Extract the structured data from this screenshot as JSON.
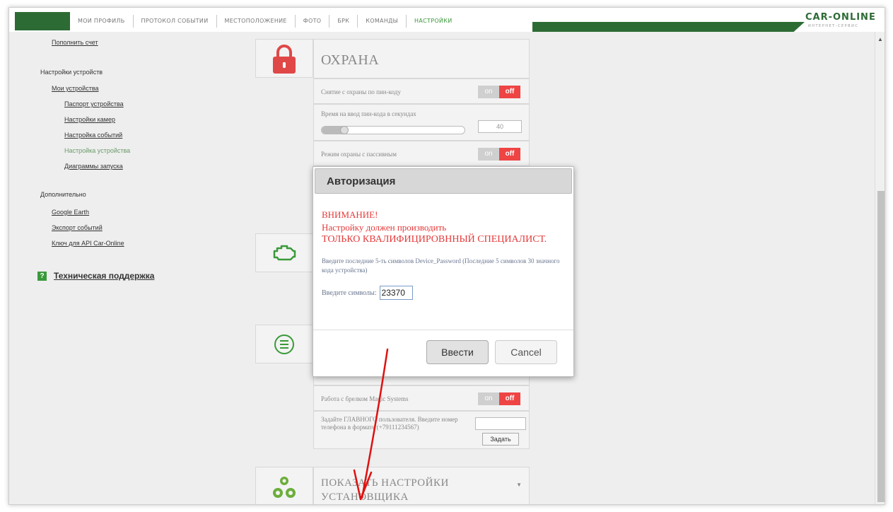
{
  "nav": {
    "tabs": [
      "МОИ ПРОФИЛЬ",
      "ПРОТОКОЛ СОБЫТИИ",
      "МЕСТОПОЛОЖЕНИЕ",
      "ФОТО",
      "БРК",
      "КОМАНДЫ",
      "НАСТРОЙКИ"
    ],
    "active_tab": "НАСТРОЙКИ",
    "logo": "CAR-ONLINE",
    "logo_sub": "ИНТЕРНЕТ-СЕРВИС"
  },
  "sidebar": {
    "topup": "Пополнить счет",
    "device_settings_heading": "Настройки устройств",
    "my_devices": "Мои устройства",
    "device_passport": "Паспорт устройства",
    "camera_settings": "Настройки камер",
    "event_settings": "Настройка событий",
    "device_setting_current": "Настройка устройства",
    "launch_diagrams": "Диаграммы запуска",
    "extra_heading": "Дополнительно",
    "google_earth": "Google Earth",
    "event_export": "Экспорт событий",
    "api_key": "Ключ для API Car-Online",
    "support_icon": "?",
    "support": "Техническая поддержка"
  },
  "settings": {
    "section_title": "ОХРАНА",
    "disarm_pin_label": "Снятие с охраны по пин-коду",
    "pin_time_label": "Время на ввод пин-кода в секундах",
    "pin_time_value": "40",
    "pin_time_fraction": 0.15,
    "passive_mode_label": "Режим охраны с пассивным",
    "keyfob_label": "Работа с брелком Magic Systems",
    "main_user_label": "Задайте ГЛАВНОГО пользователя. Введите номер телефона в формате (+79111234567)",
    "set_button": "Задать",
    "toggle_on": "on",
    "toggle_off": "off",
    "show_installer": "ПОКАЗАТЬ НАСТРОЙКИ УСТАНОВЩИКА"
  },
  "modal": {
    "title": "Авторизация",
    "warn1": "ВНИМАНИЕ!",
    "warn2": "Настройку должен производить",
    "warn3": "ТОЛЬКО КВАЛИФИЦИРОВННЫЙ СПЕЦИАЛИСТ.",
    "hint": "Введите последние 5-ть символов Device_Password (Последние 5 символов 30 значного кода устройства)",
    "code_label": "Введите символы:",
    "code_value": "23370",
    "submit": "Ввести",
    "cancel": "Cancel"
  },
  "icons": {
    "lock": "lock-icon",
    "engine": "engine-icon",
    "menu": "menu-circle-icon",
    "gears": "gears-icon",
    "annotation": "red-arrow"
  },
  "colors": {
    "brand_green": "#2d6b35",
    "active_tab": "#3a9a3a",
    "lock_red": "#e04848",
    "warning_red": "#e43a3a",
    "toggle_off": "#e44444",
    "annotation_red": "#e01010"
  }
}
